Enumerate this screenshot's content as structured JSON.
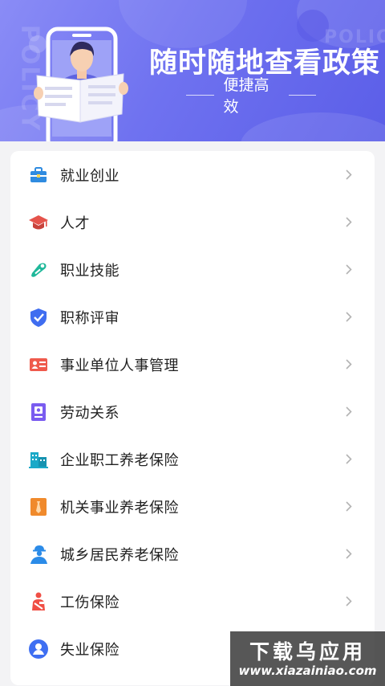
{
  "banner": {
    "title": "随时随地查看政策",
    "subtitle": "便捷高效",
    "bg_word": "POLICY",
    "colors": {
      "gradient_start": "#8a8cf6",
      "gradient_end": "#5b5ee8"
    }
  },
  "menu": [
    {
      "label": "就业创业",
      "icon": "briefcase-icon",
      "color": "#2f8be0"
    },
    {
      "label": "人才",
      "icon": "graduation-cap-icon",
      "color": "#e5534b"
    },
    {
      "label": "职业技能",
      "icon": "tool-icon",
      "color": "#1fb89a"
    },
    {
      "label": "职称评审",
      "icon": "shield-check-icon",
      "color": "#3f6df0"
    },
    {
      "label": "事业单位人事管理",
      "icon": "id-card-icon",
      "color": "#ef5a4c"
    },
    {
      "label": "劳动关系",
      "icon": "contract-icon",
      "color": "#7a5cf0"
    },
    {
      "label": "企业职工养老保险",
      "icon": "office-building-icon",
      "color": "#1aa9c8"
    },
    {
      "label": "机关事业养老保险",
      "icon": "official-tie-icon",
      "color": "#f08a2c"
    },
    {
      "label": "城乡居民养老保险",
      "icon": "worker-icon",
      "color": "#2b8be8"
    },
    {
      "label": "工伤保险",
      "icon": "injured-person-icon",
      "color": "#f04f45"
    },
    {
      "label": "失业保险",
      "icon": "person-circle-icon",
      "color": "#3f6ff2"
    }
  ],
  "watermark": {
    "title": "下载乌应用",
    "url": "www.xiazainiao.com"
  }
}
